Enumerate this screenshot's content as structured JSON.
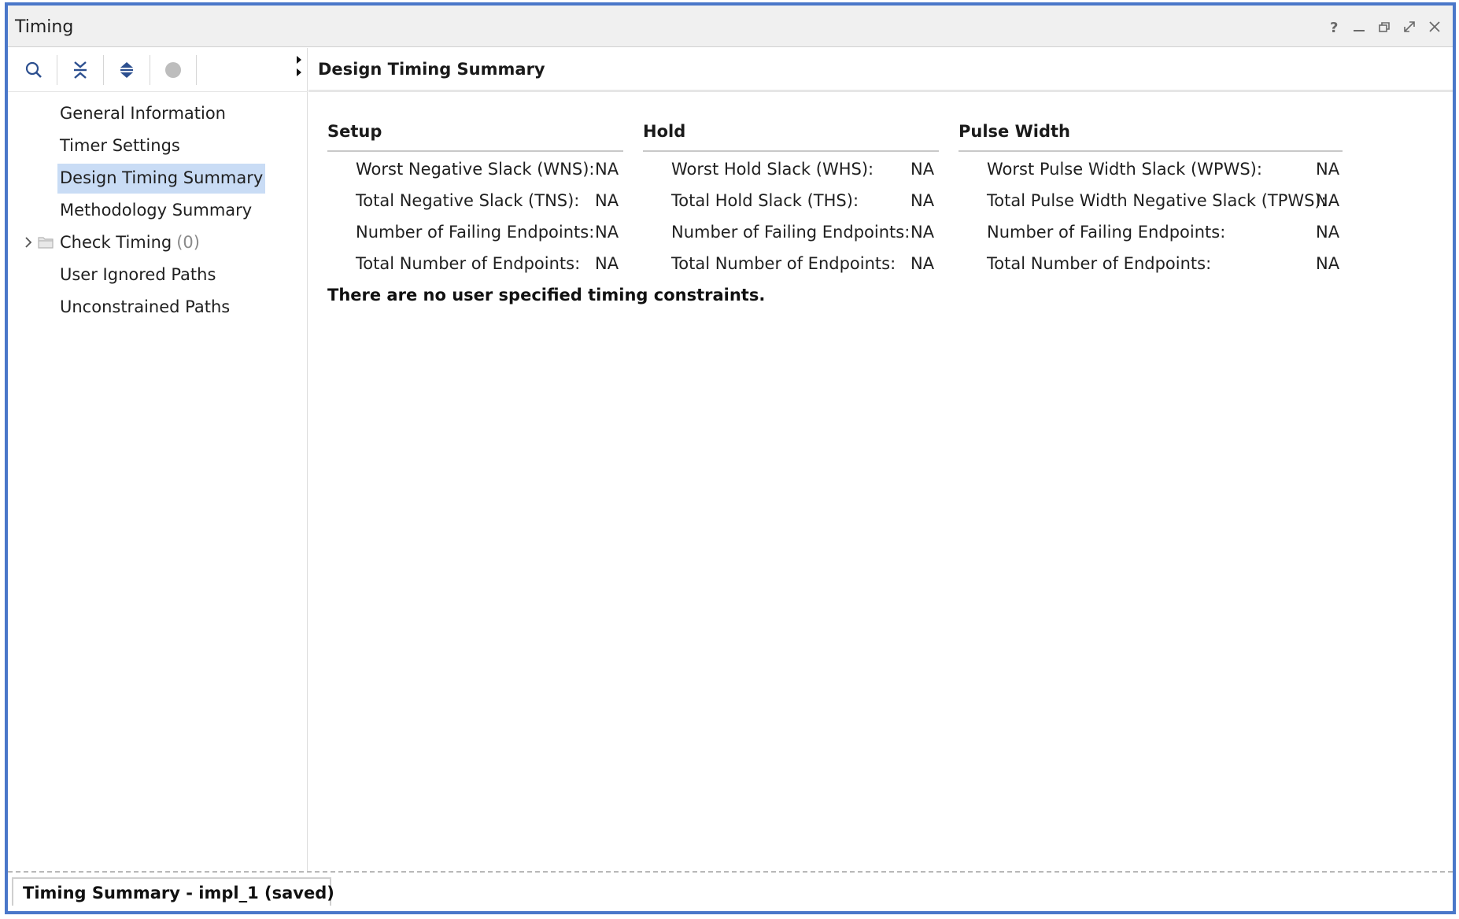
{
  "window": {
    "title": "Timing",
    "controls": [
      "help-icon",
      "minimize-icon",
      "restore-icon",
      "maximize-icon",
      "close-icon"
    ]
  },
  "toolbar": {
    "icons": [
      "search-icon",
      "collapse-all-icon",
      "expand-all-icon",
      "circle-icon"
    ]
  },
  "tree": {
    "items": [
      {
        "label": "General Information"
      },
      {
        "label": "Timer Settings"
      },
      {
        "label": "Design Timing Summary",
        "selected": true
      },
      {
        "label": "Methodology Summary"
      },
      {
        "label": "Check Timing",
        "count": "(0)",
        "expandable": true
      },
      {
        "label": "User Ignored Paths"
      },
      {
        "label": "Unconstrained Paths"
      }
    ]
  },
  "main": {
    "header": "Design Timing Summary",
    "setup": {
      "title": "Setup",
      "rows": [
        {
          "label": "Worst Negative Slack (WNS):",
          "value": "NA"
        },
        {
          "label": "Total Negative Slack (TNS):",
          "value": "NA"
        },
        {
          "label": "Number of Failing Endpoints:",
          "value": "NA"
        },
        {
          "label": "Total Number of Endpoints:",
          "value": "NA"
        }
      ]
    },
    "hold": {
      "title": "Hold",
      "rows": [
        {
          "label": "Worst Hold Slack (WHS):",
          "value": "NA"
        },
        {
          "label": "Total Hold Slack (THS):",
          "value": "NA"
        },
        {
          "label": "Number of Failing Endpoints:",
          "value": "NA"
        },
        {
          "label": "Total Number of Endpoints:",
          "value": "NA"
        }
      ]
    },
    "pulse_width": {
      "title": "Pulse Width",
      "rows": [
        {
          "label": "Worst Pulse Width Slack (WPWS):",
          "value": "NA"
        },
        {
          "label": "Total Pulse Width Negative Slack (TPWS):",
          "value": "NA"
        },
        {
          "label": "Number of Failing Endpoints:",
          "value": "NA"
        },
        {
          "label": "Total Number of Endpoints:",
          "value": "NA"
        }
      ]
    },
    "message": "There are no user specified timing constraints."
  },
  "bottom_tab": {
    "label": "Timing Summary - impl_1 (saved)"
  },
  "colors": {
    "accent": "#4a77c9",
    "selection": "#c9dcf5",
    "icon": "#2c4f8f"
  }
}
